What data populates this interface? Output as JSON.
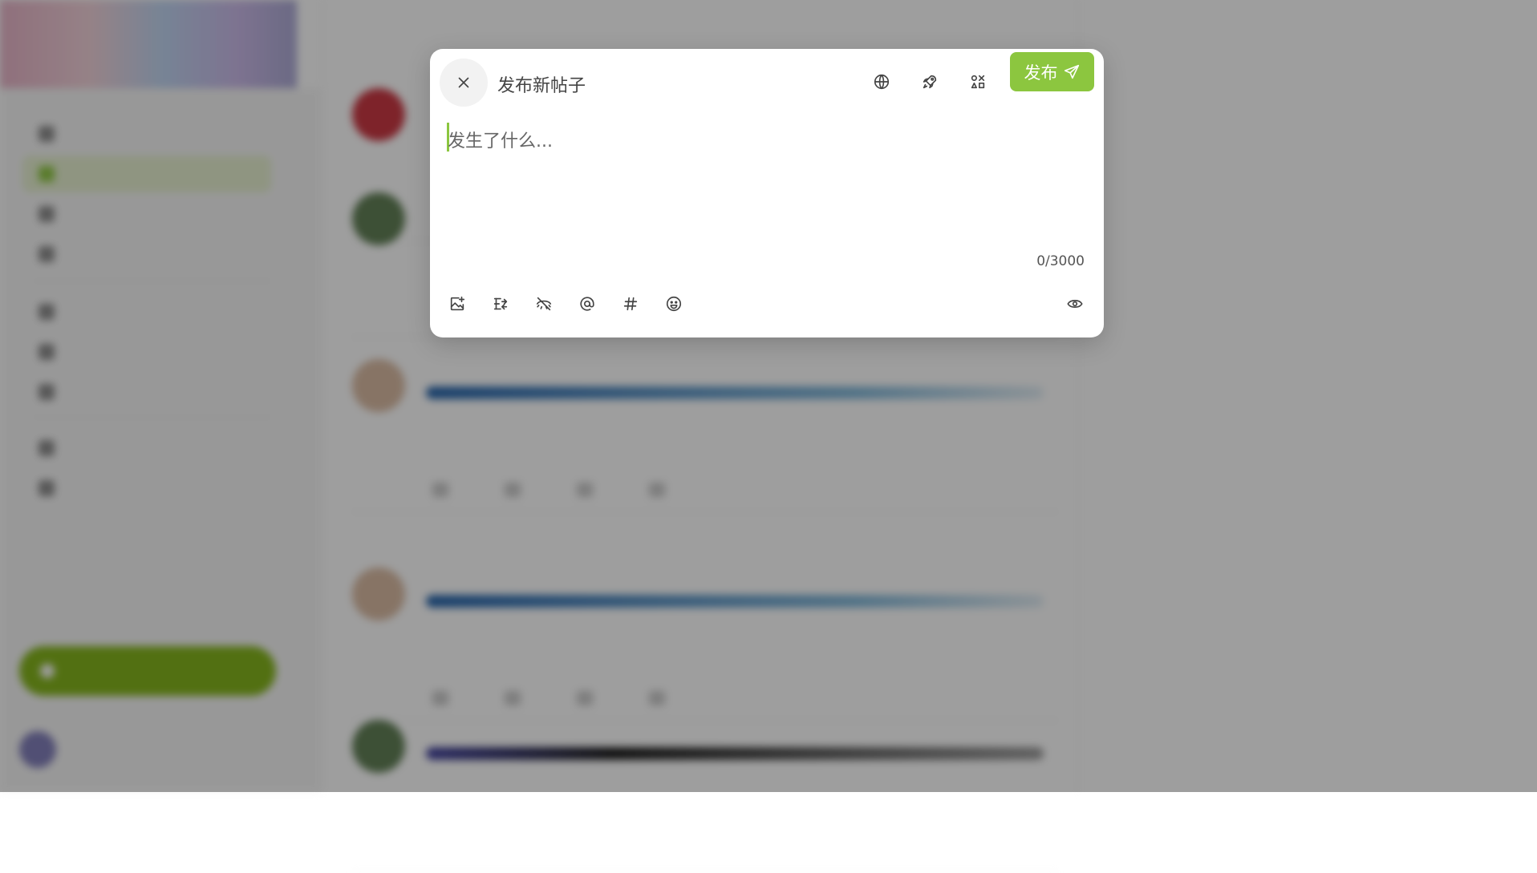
{
  "modal": {
    "title": "发布新帖子",
    "publish_label": "发布",
    "editor_placeholder": "发生了什么...",
    "char_count": "0/3000",
    "header_icons": [
      "globe-icon",
      "rocket-icon",
      "apps-icon"
    ],
    "toolbar_icons": [
      "image-plus-icon",
      "poll-icon",
      "eye-off-icon",
      "at-sign-icon",
      "hash-icon",
      "emoji-icon",
      "eye-icon"
    ],
    "colors": {
      "accent": "#8cc63f",
      "overlay": "#000000"
    }
  }
}
